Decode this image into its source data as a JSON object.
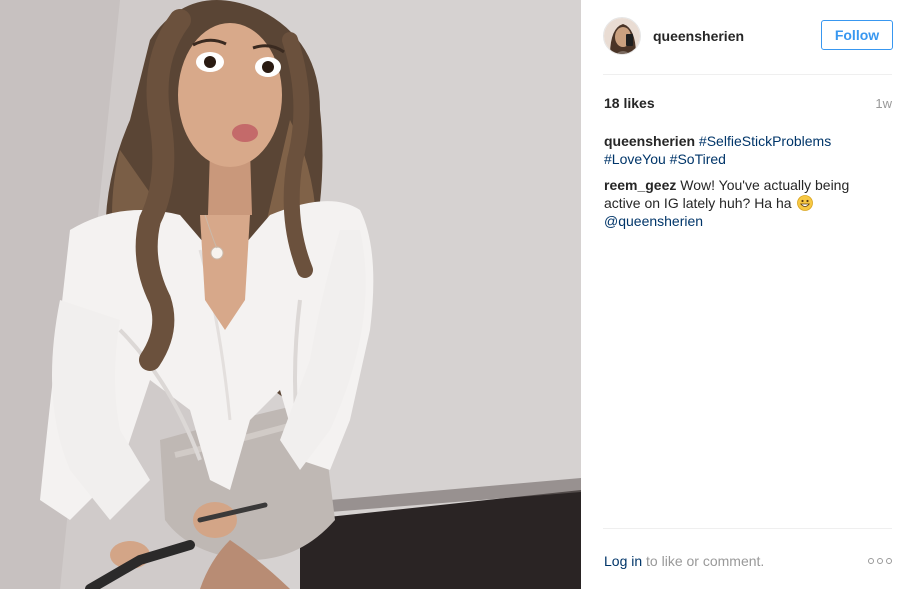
{
  "post": {
    "photo_alt": "queensherien photo",
    "author": {
      "username": "queensherien",
      "avatar_icon": "avatar-photo"
    },
    "follow_label": "Follow",
    "likes": "18 likes",
    "time_ago": "1w",
    "caption": {
      "username": "queensherien",
      "hashtags": [
        "#SelfieStickProblems",
        "#LoveYou",
        "#SoTired"
      ]
    },
    "comments": [
      {
        "username": "reem_geez",
        "text": "Wow! You've actually being active on IG lately huh? Ha ha",
        "emoji": "grinning-face-emoji",
        "mention": "@queensherien"
      }
    ],
    "footer": {
      "login_label": "Log in",
      "suffix": "to like or comment.",
      "more_icon": "more-options-icon"
    }
  },
  "colors": {
    "link_blue": "#003569",
    "follow_blue": "#3897f0",
    "text": "#262626",
    "muted": "#999999",
    "divider": "#efefef"
  }
}
